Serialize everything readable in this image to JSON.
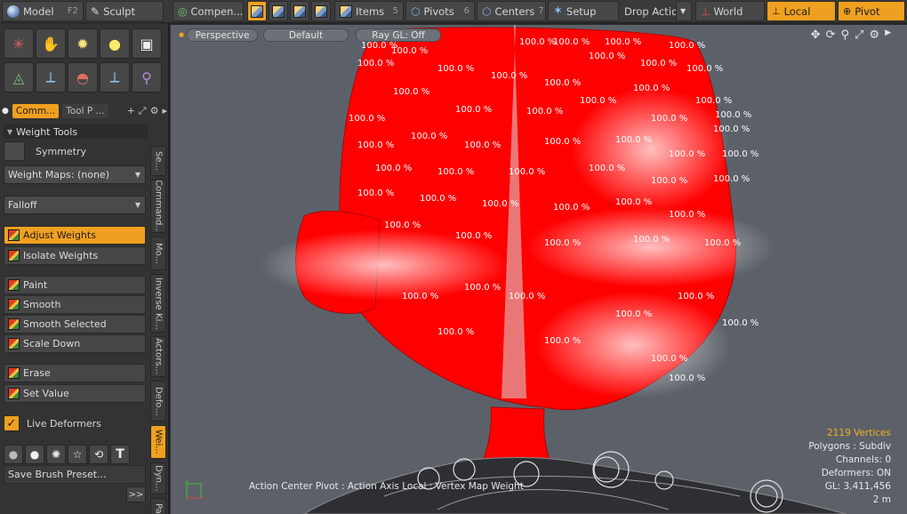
{
  "toolbar": {
    "model_label": "Model",
    "model_key": "F2",
    "sculpt_label": "Sculpt",
    "compen_label": "Compen...",
    "items_label": "Items",
    "items_key": "5",
    "pivots_label": "Pivots",
    "pivots_key": "6",
    "centers_label": "Centers",
    "centers_key": "7",
    "setup_label": "Setup",
    "drop_action_label": "Drop Action",
    "world_label": "World",
    "local_label": "Local",
    "pivot_label": "Pivot"
  },
  "panel": {
    "tab_commands": "Comm...",
    "tab_toolprops": "Tool P ...",
    "weight_tools_header": "Weight Tools",
    "symmetry_label": "Symmetry",
    "weight_maps_dropdown": "Weight Maps: (none)",
    "falloff_dropdown": "Falloff",
    "buttons": {
      "adjust_weights": "Adjust Weights",
      "isolate_weights": "Isolate Weights",
      "paint": "Paint",
      "smooth": "Smooth",
      "smooth_selected": "Smooth Selected",
      "scale_down": "Scale Down",
      "erase": "Erase",
      "set_value": "Set Value"
    },
    "live_deformers_label": "Live Deformers",
    "save_brush_preset": "Save Brush Preset...",
    "expand_glyph": ">>"
  },
  "vertical_tabs": [
    "Se...",
    "Command...",
    "Mo...",
    "Inverse Ki...",
    "Actors...",
    "Defo...",
    "Wei...",
    "Dyn...",
    "Par..."
  ],
  "viewport": {
    "perspective_label": "Perspective",
    "default_label": "Default",
    "raygl_label": "Ray GL: Off",
    "weight_value_label": "100.0 %",
    "status_text": "Action Center Pivot : Action Axis Local : Vertex Map Weight",
    "stats": {
      "vertices": "2119 Vertices",
      "polygons": "Polygons : Subdiv",
      "channels": "Channels: 0",
      "deformers": "Deformers: ON",
      "gl": "GL: 3,411,456",
      "distance": "2 m"
    }
  },
  "colors": {
    "accent": "#f0a020",
    "weight_red": "#ff0000",
    "viewport_bg": "#5c6169"
  }
}
